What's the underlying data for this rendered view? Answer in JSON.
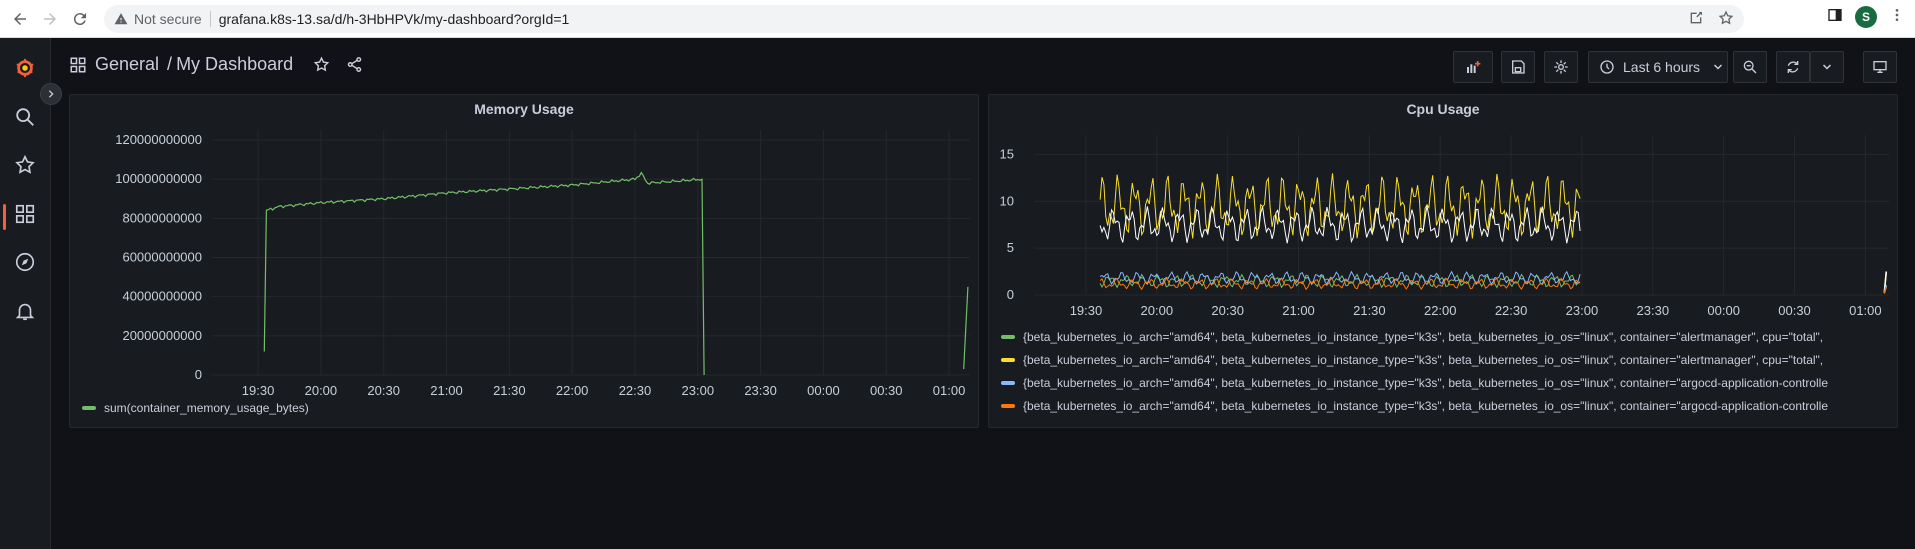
{
  "browser": {
    "security_label": "Not secure",
    "url": "grafana.k8s-13.sa/d/h-3HbHPVk/my-dashboard?orgId=1",
    "profile_initial": "S"
  },
  "dashboard": {
    "folder": "General",
    "separator": "/",
    "title": "My Dashboard",
    "time_range": "Last 6 hours"
  },
  "colors": {
    "accent": "#f55f3e",
    "green": "#73bf69",
    "yellow": "#fade2a",
    "blue": "#8ab8ff",
    "orange": "#ff780a",
    "white": "#ffffff"
  },
  "memory_panel": {
    "title": "Memory Usage",
    "legend": "sum(container_memory_usage_bytes)"
  },
  "cpu_panel": {
    "title": "Cpu Usage",
    "legend": [
      {
        "label": "{beta_kubernetes_io_arch=\"amd64\", beta_kubernetes_io_instance_type=\"k3s\", beta_kubernetes_io_os=\"linux\", container=\"alertmanager\", cpu=\"total\",",
        "color": "#73bf69"
      },
      {
        "label": "{beta_kubernetes_io_arch=\"amd64\", beta_kubernetes_io_instance_type=\"k3s\", beta_kubernetes_io_os=\"linux\", container=\"alertmanager\", cpu=\"total\",",
        "color": "#fade2a"
      },
      {
        "label": "{beta_kubernetes_io_arch=\"amd64\", beta_kubernetes_io_instance_type=\"k3s\", beta_kubernetes_io_os=\"linux\", container=\"argocd-application-controlle",
        "color": "#8ab8ff"
      },
      {
        "label": "{beta_kubernetes_io_arch=\"amd64\", beta_kubernetes_io_instance_type=\"k3s\", beta_kubernetes_io_os=\"linux\", container=\"argocd-application-controlle",
        "color": "#ff780a"
      }
    ]
  },
  "chart_data": [
    {
      "type": "line",
      "title": "Memory Usage",
      "xlabel": "",
      "ylabel": "",
      "x_ticks": [
        "19:30",
        "20:00",
        "20:30",
        "21:00",
        "21:30",
        "22:00",
        "22:30",
        "23:00",
        "23:30",
        "00:00",
        "00:30",
        "01:00"
      ],
      "y_ticks": [
        "0",
        "20000000000",
        "40000000000",
        "60000000000",
        "80000000000",
        "100000000000",
        "120000000000"
      ],
      "ylim": [
        0,
        120000000000
      ],
      "series": [
        {
          "name": "sum(container_memory_usage_bytes)",
          "color": "#73bf69",
          "points": [
            [
              "19:33",
              12000000000
            ],
            [
              "19:34",
              84000000000
            ],
            [
              "19:40",
              86000000000
            ],
            [
              "20:00",
              88000000000
            ],
            [
              "20:30",
              90000000000
            ],
            [
              "21:00",
              93000000000
            ],
            [
              "21:30",
              95000000000
            ],
            [
              "22:00",
              97000000000
            ],
            [
              "22:30",
              100000000000
            ],
            [
              "22:33",
              103000000000
            ],
            [
              "22:36",
              98000000000
            ],
            [
              "22:50",
              99000000000
            ],
            [
              "23:02",
              100000000000
            ],
            [
              "23:03",
              0
            ]
          ],
          "tail_points": [
            [
              "01:07",
              3000000000
            ],
            [
              "01:09",
              45000000000
            ]
          ]
        }
      ]
    },
    {
      "type": "line",
      "title": "Cpu Usage",
      "xlabel": "",
      "ylabel": "",
      "x_ticks": [
        "19:30",
        "20:00",
        "20:30",
        "21:00",
        "21:30",
        "22:00",
        "22:30",
        "23:00",
        "23:30",
        "00:00",
        "00:30",
        "01:00"
      ],
      "y_ticks": [
        "0",
        "5",
        "10",
        "15"
      ],
      "ylim": [
        0,
        16
      ],
      "active_range": [
        "19:36",
        "23:00"
      ],
      "series": [
        {
          "name": "yellow series (container=\"alertmanager\")",
          "color": "#fade2a",
          "approx_mean": 9.5,
          "approx_amplitude": 3.5
        },
        {
          "name": "white series",
          "color": "#ffffff",
          "approx_mean": 7.5,
          "approx_amplitude": 2
        },
        {
          "name": "green series (container=\"alertmanager\")",
          "color": "#73bf69",
          "approx_mean": 1.5,
          "approx_amplitude": 0.7
        },
        {
          "name": "blue series (container=\"argocd-application-controlle\")",
          "color": "#8ab8ff",
          "approx_mean": 1.8,
          "approx_amplitude": 0.7
        },
        {
          "name": "orange series (container=\"argocd-application-controlle\")",
          "color": "#ff780a",
          "approx_mean": 1.2,
          "approx_amplitude": 0.6
        }
      ]
    }
  ]
}
